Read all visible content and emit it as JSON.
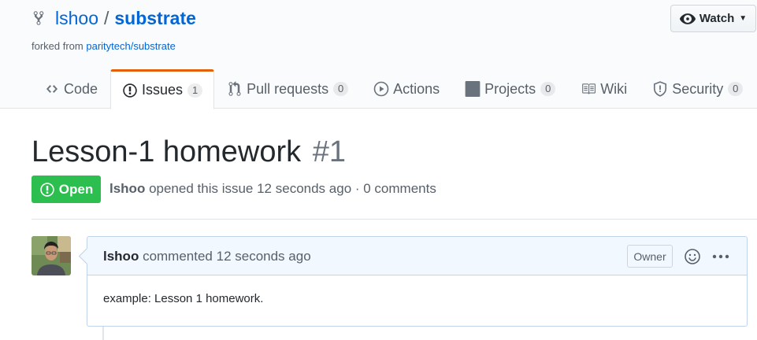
{
  "repo": {
    "owner": "lshoo",
    "separator": "/",
    "name": "substrate",
    "forked_prefix": "forked from ",
    "forked_from": "paritytech/substrate"
  },
  "watch": {
    "label": "Watch"
  },
  "tabs": [
    {
      "label": "Code",
      "icon": "code-icon"
    },
    {
      "label": "Issues",
      "count": "1",
      "icon": "issue-opened-icon",
      "selected": true
    },
    {
      "label": "Pull requests",
      "count": "0",
      "icon": "pull-request-icon"
    },
    {
      "label": "Actions",
      "icon": "play-icon"
    },
    {
      "label": "Projects",
      "count": "0",
      "icon": "project-icon"
    },
    {
      "label": "Wiki",
      "icon": "book-icon"
    },
    {
      "label": "Security",
      "count": "0",
      "icon": "shield-icon"
    }
  ],
  "issue": {
    "title": "Lesson-1 homework",
    "number": "#1",
    "state": "Open",
    "author": "lshoo",
    "meta": " opened this issue 12 seconds ago · 0 comments"
  },
  "comment": {
    "author": "lshoo",
    "action": " commented 12 seconds ago",
    "badge": "Owner",
    "body": "example: Lesson 1 homework."
  },
  "colors": {
    "accent_link": "#0366d6",
    "open_green": "#2cbe4e",
    "selected_tab_border": "#e36209",
    "comment_header_bg": "#f1f8ff"
  }
}
